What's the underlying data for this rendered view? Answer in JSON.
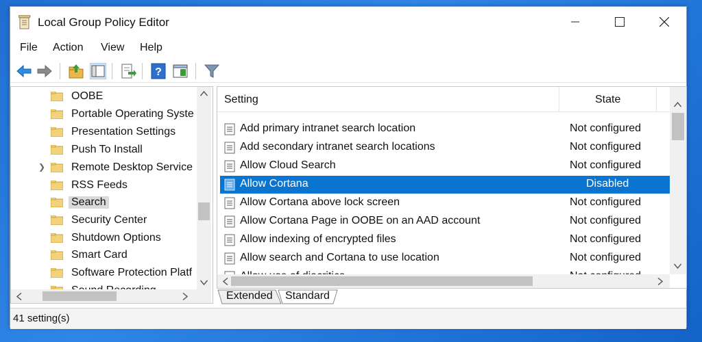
{
  "window": {
    "title": "Local Group Policy Editor",
    "controls": {
      "minimize": "—",
      "maximize": "☐",
      "close": "✕"
    }
  },
  "menu": [
    "File",
    "Action",
    "View",
    "Help"
  ],
  "toolbar": {
    "icons": [
      "back-arrow-icon",
      "forward-arrow-icon",
      "up-folder-icon",
      "show-hide-tree-icon",
      "export-list-icon",
      "help-icon",
      "extended-view-icon",
      "filter-icon"
    ]
  },
  "tree": {
    "items": [
      {
        "label": "OOBE"
      },
      {
        "label": "Portable Operating Syste"
      },
      {
        "label": "Presentation Settings"
      },
      {
        "label": "Push To Install"
      },
      {
        "label": "Remote Desktop Service"
      },
      {
        "label": "RSS Feeds"
      },
      {
        "label": "Search"
      },
      {
        "label": "Security Center"
      },
      {
        "label": "Shutdown Options"
      },
      {
        "label": "Smart Card"
      },
      {
        "label": "Software Protection Platf"
      },
      {
        "label": "Sound Recording"
      }
    ],
    "selected_index": 6,
    "expandable_index": 4
  },
  "list": {
    "columns": {
      "setting": "Setting",
      "state": "State"
    },
    "rows": [
      {
        "setting": "Add primary intranet search location",
        "state": "Not configured"
      },
      {
        "setting": "Add secondary intranet search locations",
        "state": "Not configured"
      },
      {
        "setting": "Allow Cloud Search",
        "state": "Not configured"
      },
      {
        "setting": "Allow Cortana",
        "state": "Disabled"
      },
      {
        "setting": "Allow Cortana above lock screen",
        "state": "Not configured"
      },
      {
        "setting": "Allow Cortana Page in OOBE on an AAD account",
        "state": "Not configured"
      },
      {
        "setting": "Allow indexing of encrypted files",
        "state": "Not configured"
      },
      {
        "setting": "Allow search and Cortana to use location",
        "state": "Not configured"
      },
      {
        "setting": "Allow use of diacritics",
        "state": "Not configured"
      }
    ],
    "selected_index": 3
  },
  "tabs": [
    "Extended",
    "Standard"
  ],
  "active_tab": "Standard",
  "status": {
    "text": "41 setting(s)"
  },
  "colors": {
    "selection": "#0a74d1",
    "tree_selection": "#d9d9d9",
    "desktop": "#1f6fd1"
  }
}
